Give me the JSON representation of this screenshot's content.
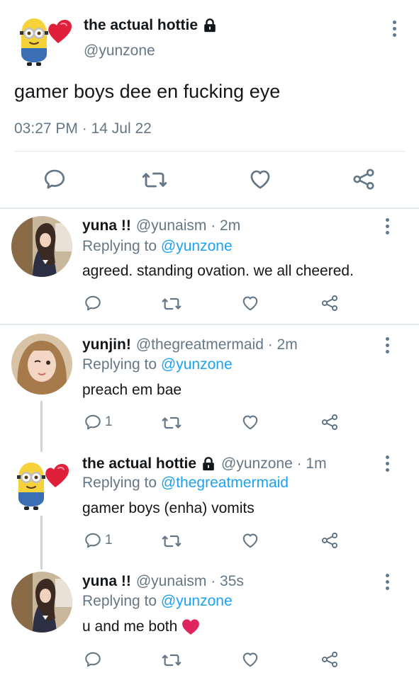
{
  "main_tweet": {
    "display_name": "the actual hottie",
    "handle": "@yunzone",
    "text": "gamer boys dee en fucking eye",
    "time": "03:27 PM",
    "separator": "·",
    "date": "14 Jul 22"
  },
  "replies": [
    {
      "display_name": "yuna !!",
      "handle": "@yunaism · 2m",
      "replying_prefix": "Replying to",
      "replying_to": "@yunzone",
      "text": "agreed. standing ovation. we all cheered.",
      "reply_count": ""
    },
    {
      "display_name": "yunjin!",
      "handle": "@thegreatmermaid · 2m",
      "replying_prefix": "Replying to",
      "replying_to": "@yunzone",
      "text": "preach em bae",
      "reply_count": "1"
    },
    {
      "display_name": "the actual hottie",
      "handle": "@yunzone · 1m",
      "replying_prefix": "Replying to",
      "replying_to": "@thegreatmermaid",
      "text": "gamer boys (enha) vomits",
      "reply_count": "1"
    },
    {
      "display_name": "yuna !!",
      "handle": "@yunaism · 35s",
      "replying_prefix": "Replying to",
      "replying_to": "@yunzone",
      "text": "u and me both",
      "reply_count": ""
    }
  ],
  "icons": {
    "lock": "lock-icon",
    "more": "more-vertical-icon",
    "reply": "reply-icon",
    "retweet": "retweet-icon",
    "like": "heart-icon",
    "share": "share-icon",
    "heart_emoji": "red-heart-emoji"
  },
  "colors": {
    "text": "#14171a",
    "muted": "#657786",
    "link": "#1da1f2",
    "divider": "#e1e8ed",
    "thread_line": "#ccd6dd",
    "heart": "#e0245e"
  }
}
